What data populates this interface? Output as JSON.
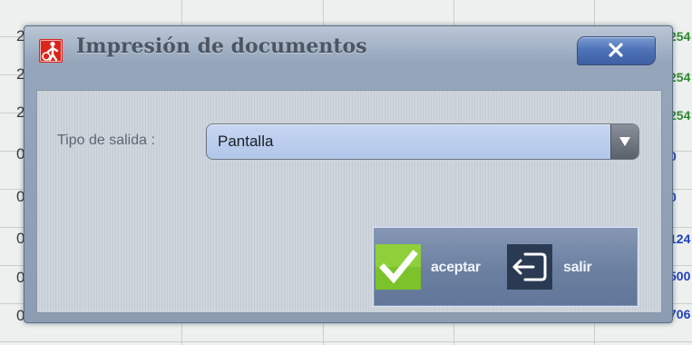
{
  "dialog": {
    "title": "Impresión de documentos",
    "title_icon": "print-person-icon",
    "close_icon": "close-icon"
  },
  "form": {
    "output_type_label": "Tipo de salida :",
    "output_type_value": "Pantalla",
    "dropdown_icon": "chevron-down-icon"
  },
  "buttons": {
    "accept_label": "aceptar",
    "accept_icon": "checkmark-icon",
    "exit_label": "salir",
    "exit_icon": "exit-icon"
  },
  "background_sheet": {
    "left_column": [
      "2",
      "2",
      "2",
      "0",
      "0",
      "0",
      "0",
      "0"
    ],
    "right_column": [
      {
        "text": "254",
        "color": "#2e8b2e"
      },
      {
        "text": "254",
        "color": "#2e8b2e"
      },
      {
        "text": "254",
        "color": "#2e8b2e"
      },
      {
        "text": "0",
        "color": "#1f3fbf"
      },
      {
        "text": "0",
        "color": "#1f3fbf"
      },
      {
        "text": "124",
        "color": "#1f3fbf"
      },
      {
        "text": "500",
        "color": "#1f3fbf"
      },
      {
        "text": "706",
        "color": "#1f3fbf"
      }
    ]
  },
  "colors": {
    "dialog_frame": "#8c9db2",
    "close_button": "#4f73b8",
    "select_fill": "#b1c6ea",
    "accept_icon_bg": "#7cc22a",
    "exit_icon_bg": "#2a3a52"
  }
}
